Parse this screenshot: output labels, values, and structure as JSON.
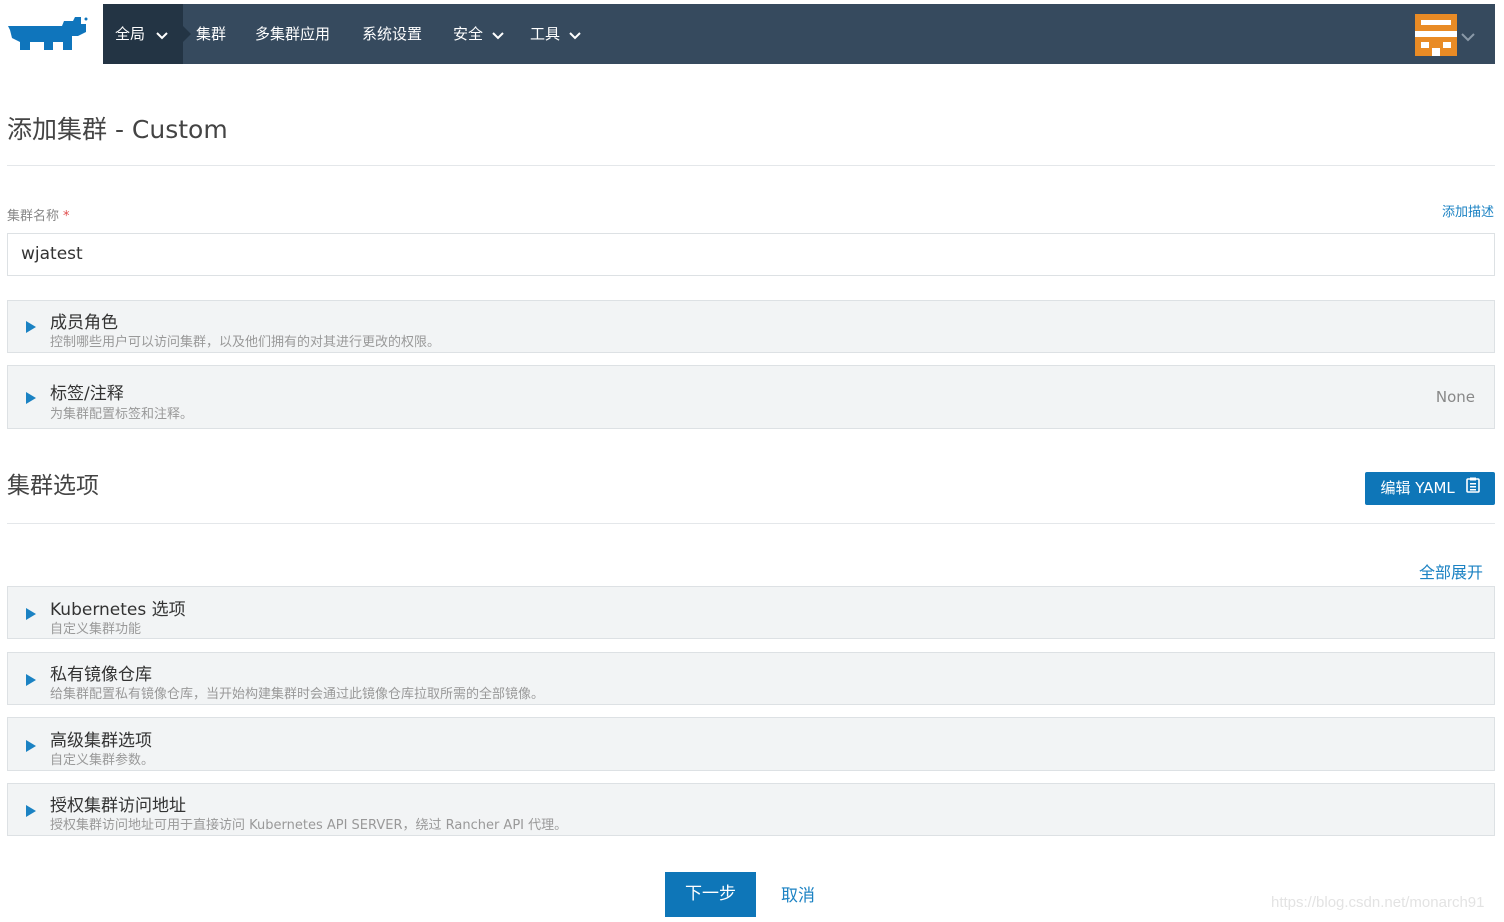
{
  "nav": {
    "logo_icon": "rancher-cow-logo",
    "items": [
      {
        "label": "全局",
        "has_dropdown": true,
        "active": true
      },
      {
        "label": "集群",
        "has_dropdown": false
      },
      {
        "label": "多集群应用",
        "has_dropdown": false
      },
      {
        "label": "系统设置",
        "has_dropdown": false
      },
      {
        "label": "安全",
        "has_dropdown": true
      },
      {
        "label": "工具",
        "has_dropdown": true
      }
    ],
    "avatar_icon": "user-avatar-icon",
    "colors": {
      "bar": "#364a5e",
      "active": "#233444"
    }
  },
  "page": {
    "title": "添加集群 - Custom"
  },
  "cluster_name": {
    "label": "集群名称",
    "required_mark": "*",
    "value": "wjatest",
    "add_description_link": "添加描述"
  },
  "panels_top": [
    {
      "title": "成员角色",
      "desc": "控制哪些用户可以访问集群，以及他们拥有的对其进行更改的权限。",
      "right": ""
    },
    {
      "title": "标签/注释",
      "desc": "为集群配置标签和注释。",
      "right": "None"
    }
  ],
  "cluster_options": {
    "heading": "集群选项",
    "edit_yaml_label": "编辑 YAML",
    "expand_all_link": "全部展开"
  },
  "panels_options": [
    {
      "title": "Kubernetes 选项",
      "desc": "自定义集群功能"
    },
    {
      "title": "私有镜像仓库",
      "desc": "给集群配置私有镜像仓库，当开始构建集群时会通过此镜像仓库拉取所需的全部镜像。"
    },
    {
      "title": "高级集群选项",
      "desc": "自定义集群参数。"
    },
    {
      "title": "授权集群访问地址",
      "desc": "授权集群访问地址可用于直接访问 Kubernetes API SERVER，绕过 Rancher API 代理。"
    }
  ],
  "footer": {
    "next_label": "下一步",
    "cancel_label": "取消",
    "watermark": "https://blog.csdn.net/monarch91"
  },
  "colors": {
    "primary": "#0e76b8",
    "link": "#1b82c3",
    "required": "#e04b4b"
  }
}
